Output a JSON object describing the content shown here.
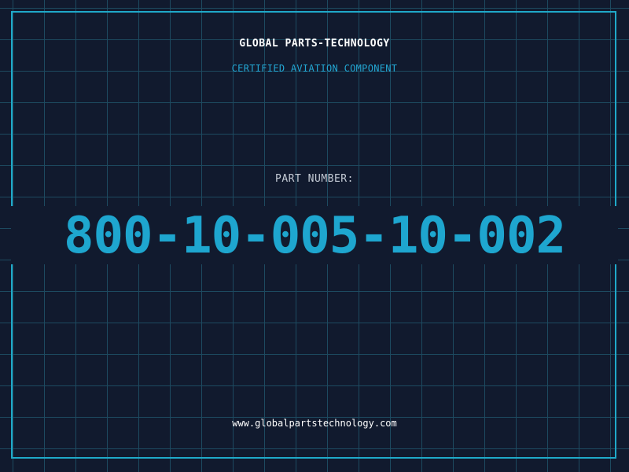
{
  "header": {
    "company": "GLOBAL PARTS-TECHNOLOGY",
    "tagline": "CERTIFIED AVIATION COMPONENT"
  },
  "part": {
    "label": "PART NUMBER:",
    "number": "800-10-005-10-002"
  },
  "footer": {
    "url": "www.globalpartstechnology.com"
  },
  "colors": {
    "background": "#111a2e",
    "grid": "#1d4a60",
    "accent": "#1ea6cf",
    "text": "#ffffff"
  }
}
